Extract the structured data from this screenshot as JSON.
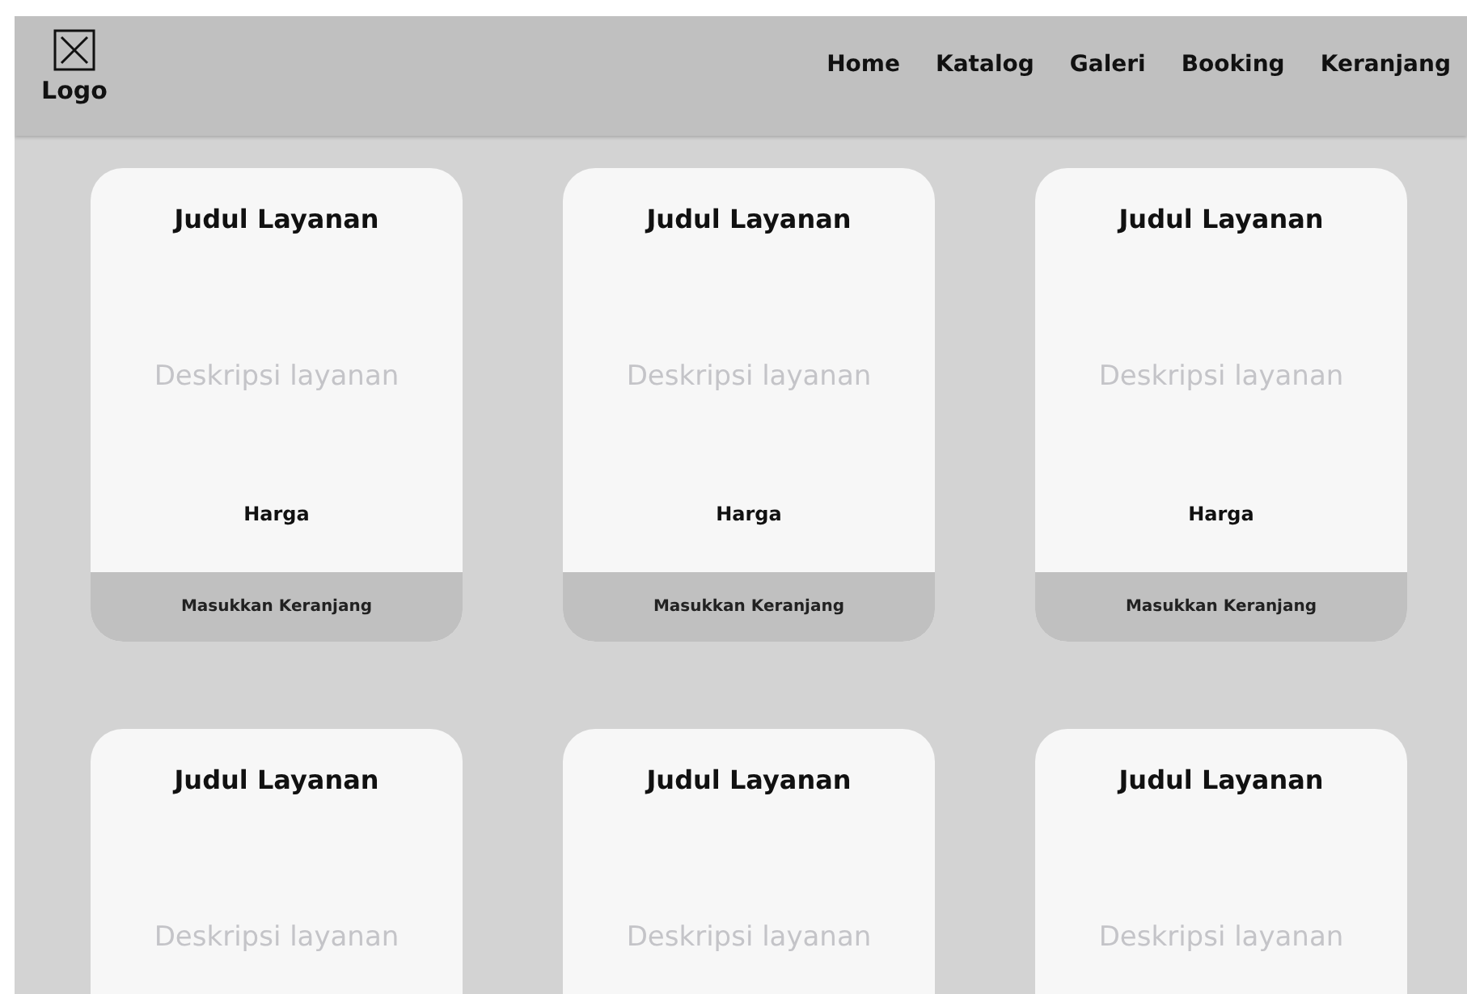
{
  "header": {
    "logo_label": "Logo",
    "nav": [
      {
        "label": "Home"
      },
      {
        "label": "Katalog"
      },
      {
        "label": "Galeri"
      },
      {
        "label": "Booking"
      },
      {
        "label": "Keranjang"
      }
    ]
  },
  "cards": [
    {
      "title": "Judul Layanan",
      "description": "Deskripsi layanan",
      "price": "Harga",
      "button": "Masukkan Keranjang"
    },
    {
      "title": "Judul Layanan",
      "description": "Deskripsi layanan",
      "price": "Harga",
      "button": "Masukkan Keranjang"
    },
    {
      "title": "Judul Layanan",
      "description": "Deskripsi layanan",
      "price": "Harga",
      "button": "Masukkan Keranjang"
    },
    {
      "title": "Judul Layanan",
      "description": "Deskripsi layanan"
    },
    {
      "title": "Judul Layanan",
      "description": "Deskripsi layanan"
    },
    {
      "title": "Judul Layanan",
      "description": "Deskripsi layanan"
    }
  ]
}
